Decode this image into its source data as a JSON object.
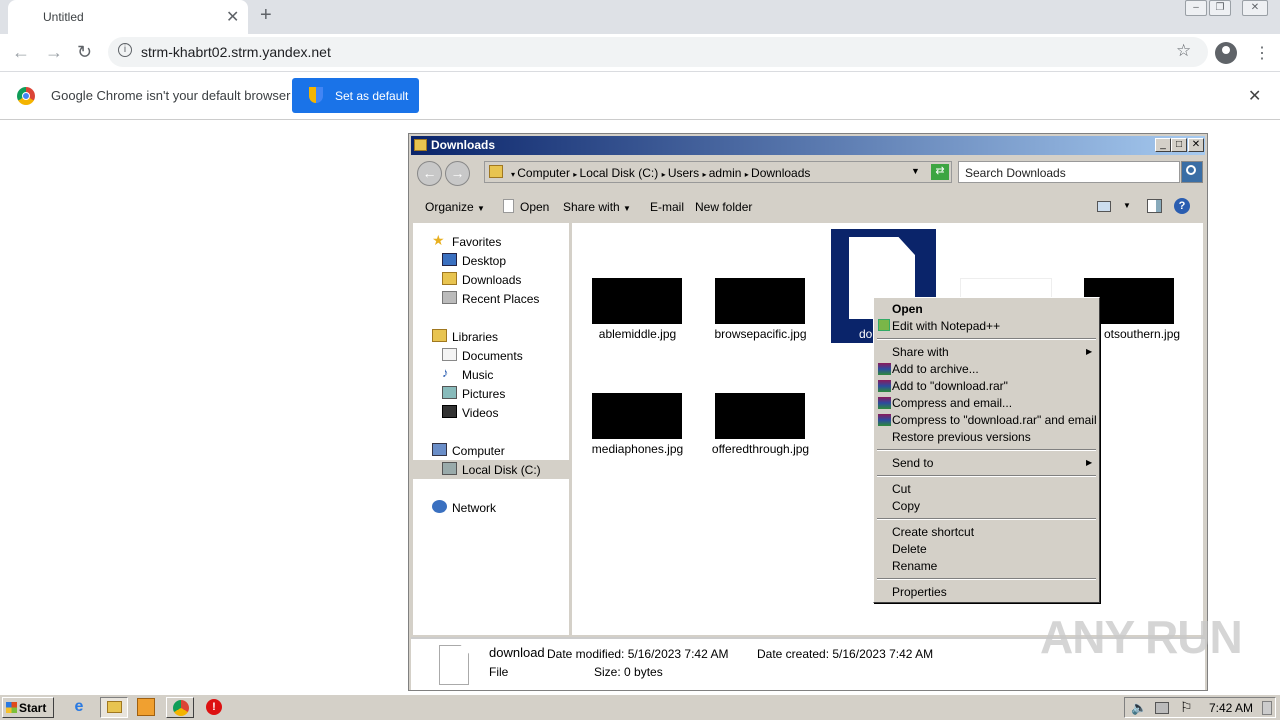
{
  "browser": {
    "tab_title": "Untitled",
    "url": "strm-khabrt02.strm.yandex.net",
    "infobar_text": "Google Chrome isn't your default browser",
    "set_default_label": "Set as default"
  },
  "explorer": {
    "title": "Downloads",
    "breadcrumb": [
      "Computer",
      "Local Disk (C:)",
      "Users",
      "admin",
      "Downloads"
    ],
    "search_placeholder": "Search Downloads",
    "commands": {
      "organize": "Organize",
      "open": "Open",
      "share_with": "Share with",
      "email": "E-mail",
      "new_folder": "New folder"
    },
    "nav": {
      "favorites": "Favorites",
      "desktop": "Desktop",
      "downloads": "Downloads",
      "recent_places": "Recent Places",
      "libraries": "Libraries",
      "documents": "Documents",
      "music": "Music",
      "pictures": "Pictures",
      "videos": "Videos",
      "computer": "Computer",
      "local_disk": "Local Disk (C:)",
      "network": "Network"
    },
    "files": {
      "f1": "ablemiddle.jpg",
      "f2": "browsepacific.jpg",
      "f3": "do",
      "f5": "otsouthern.jpg",
      "f6": "mediaphones.jpg",
      "f7": "offeredthrough.jpg"
    },
    "details": {
      "name": "download",
      "type": "File",
      "modified": "Date modified: 5/16/2023 7:42 AM",
      "created": "Date created: 5/16/2023 7:42 AM",
      "size": "Size: 0 bytes"
    }
  },
  "context_menu": {
    "open": "Open",
    "edit_notepad": "Edit with Notepad++",
    "share_with": "Share with",
    "add_archive": "Add to archive...",
    "add_rar": "Add to \"download.rar\"",
    "compress_email": "Compress and email...",
    "compress_rar_email": "Compress to \"download.rar\" and email",
    "restore": "Restore previous versions",
    "send_to": "Send to",
    "cut": "Cut",
    "copy": "Copy",
    "create_shortcut": "Create shortcut",
    "delete": "Delete",
    "rename": "Rename",
    "properties": "Properties"
  },
  "taskbar": {
    "start_label": "Start",
    "clock": "7:42 AM"
  },
  "watermark": "ANY RUN"
}
